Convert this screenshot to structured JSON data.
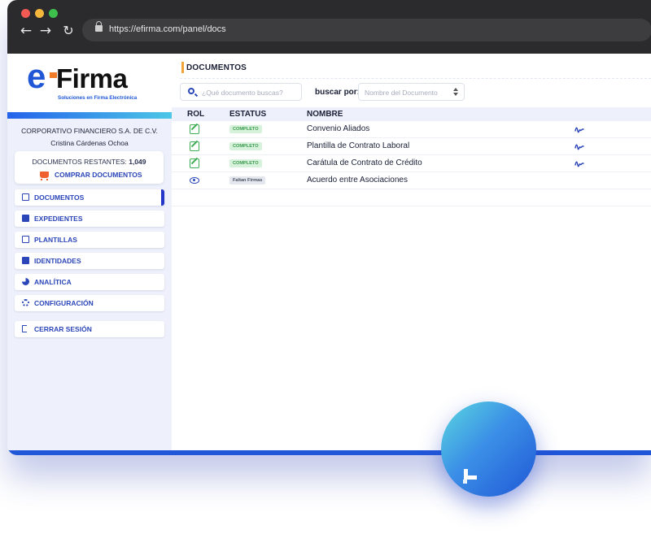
{
  "browser": {
    "url": "https://efirma.com/panel/docs"
  },
  "brand": {
    "logo_e": "e",
    "logo_name": "Firma",
    "tagline": "Soluciones en Firma Electrónica",
    "primary_color": "#1f57d6",
    "accent_color": "#f07c2a"
  },
  "account": {
    "company": "CORPORATIVO FINANCIERO S.A. DE C.V.",
    "user": "Cristina Cárdenas Ochoa",
    "remaining_label": "DOCUMENTOS RESTANTES:",
    "remaining_count": "1,049",
    "buy_label": "COMPRAR DOCUMENTOS"
  },
  "sidebar": {
    "items": [
      {
        "label": "DOCUMENTOS",
        "icon": "documents-icon",
        "active": true
      },
      {
        "label": "EXPEDIENTES",
        "icon": "archive-icon"
      },
      {
        "label": "PLANTILLAS",
        "icon": "edit-icon"
      },
      {
        "label": "IDENTIDADES",
        "icon": "id-card-icon"
      },
      {
        "label": "ANALÍTICA",
        "icon": "pie-chart-icon"
      },
      {
        "label": "CONFIGURACIÓN",
        "icon": "gears-icon"
      }
    ],
    "logout_label": "CERRAR SESIÓN"
  },
  "main": {
    "title": "DOCUMENTOS",
    "search_placeholder": "¿Qué documento buscas?",
    "filter_label": "buscar por:",
    "filter_value": "Nombre del Documento"
  },
  "table": {
    "headers": [
      "ROL",
      "ESTATUS",
      "NOMBRE"
    ],
    "rows": [
      {
        "role_icon": "edit-icon",
        "status": "COMPLETO",
        "status_color": "#3d9a4e",
        "name": "Convenio Aliados",
        "signed": true
      },
      {
        "role_icon": "edit-icon",
        "status": "COMPLETO",
        "status_color": "#3d9a4e",
        "name": "Plantilla de Contrato Laboral",
        "signed": true
      },
      {
        "role_icon": "edit-icon",
        "status": "COMPLETO",
        "status_color": "#3d9a4e",
        "name": "Carátula de Contrato de Crédito",
        "signed": true
      },
      {
        "role_icon": "eye-icon",
        "status": "Faltan Firmas",
        "status_color": "#4b5263",
        "name": "Acuerdo entre Asociaciones",
        "signed": false
      }
    ]
  }
}
